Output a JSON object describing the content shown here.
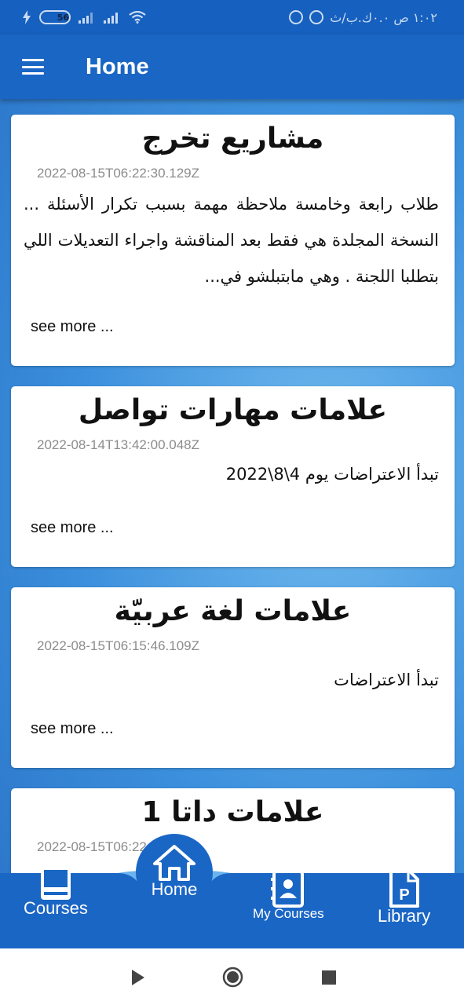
{
  "status_bar": {
    "battery": "56",
    "time_text": "١:٠٢ ص ٠.٠ك.ب/ث"
  },
  "appbar": {
    "title": "Home"
  },
  "posts": [
    {
      "title": "مشاريع تخرج",
      "date": "2022-08-15T06:22:30.129Z",
      "body": "طلاب رابعة وخامسة ملاحظة مهمة بسبب تكرار الأسئلة ... النسخة المجلدة هي فقط بعد المناقشة واجراء التعديلات اللي بتطلبا اللجنة . وهي مابتبلشو في...",
      "see_more": "see more  ..."
    },
    {
      "title": "علامات مهارات تواصل",
      "date": "2022-08-14T13:42:00.048Z",
      "body": "تبدأ الاعتراضات يوم 4\\8\\2022",
      "see_more": "see more  ..."
    },
    {
      "title": "علامات لغة عربيّة",
      "date": "2022-08-15T06:15:46.109Z",
      "body": "تبدأ الاعتراضات",
      "see_more": "see more  ..."
    },
    {
      "title": "علامات داتا 1",
      "date": "2022-08-15T06:22:30.129Z"
    }
  ],
  "bottom_nav": {
    "courses": "Courses",
    "home": "Home",
    "my_courses": "My Courses",
    "library": "Library"
  },
  "colors": {
    "primary": "#1a66c5",
    "status_bar": "#1660bf",
    "card": "#ffffff"
  }
}
